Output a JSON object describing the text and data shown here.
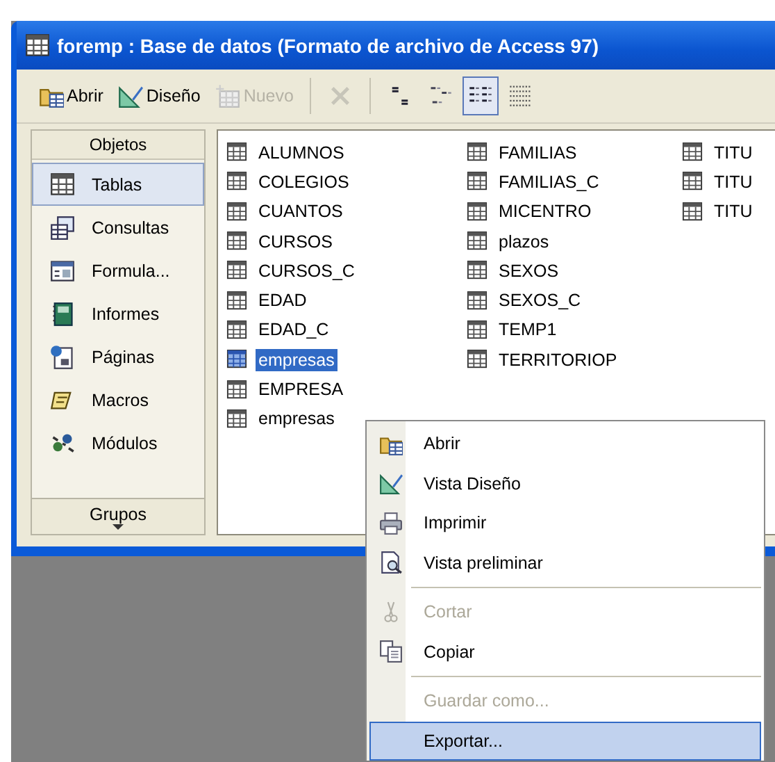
{
  "window": {
    "title": "foremp : Base de datos (Formato de archivo de Access 97)"
  },
  "toolbar": [
    {
      "kind": "button",
      "label": "Abrir",
      "disabled": false
    },
    {
      "kind": "button",
      "label": "Diseño",
      "disabled": false
    },
    {
      "kind": "button",
      "label": "Nuevo",
      "disabled": true
    },
    {
      "kind": "separator"
    },
    {
      "kind": "delete",
      "disabled": true
    },
    {
      "kind": "separator"
    },
    {
      "kind": "view",
      "selected": false
    },
    {
      "kind": "view",
      "selected": false
    },
    {
      "kind": "view",
      "selected": true
    },
    {
      "kind": "view",
      "selected": false
    }
  ],
  "sidebar": {
    "header": "Objetos",
    "items": [
      {
        "label": "Tablas",
        "selected": true
      },
      {
        "label": "Consultas",
        "selected": false
      },
      {
        "label": "Formula...",
        "selected": false
      },
      {
        "label": "Informes",
        "selected": false
      },
      {
        "label": "Páginas",
        "selected": false
      },
      {
        "label": "Macros",
        "selected": false
      },
      {
        "label": "Módulos",
        "selected": false
      }
    ],
    "groups": "Grupos"
  },
  "objects": [
    {
      "items": [
        {
          "name": "ALUMNOS",
          "selected": false
        },
        {
          "name": "COLEGIOS",
          "selected": false
        },
        {
          "name": "CUANTOS",
          "selected": false
        },
        {
          "name": "CURSOS",
          "selected": false
        },
        {
          "name": "CURSOS_C",
          "selected": false
        },
        {
          "name": "EDAD",
          "selected": false
        },
        {
          "name": "EDAD_C",
          "selected": false
        },
        {
          "name": "empresas",
          "selected": true
        },
        {
          "name": "EMPRESA",
          "selected": false
        },
        {
          "name": "empresas",
          "selected": false
        }
      ]
    },
    {
      "items": [
        {
          "name": "FAMILIAS",
          "selected": false
        },
        {
          "name": "FAMILIAS_C",
          "selected": false
        },
        {
          "name": "MICENTRO",
          "selected": false
        },
        {
          "name": "plazos",
          "selected": false
        },
        {
          "name": "SEXOS",
          "selected": false
        },
        {
          "name": "SEXOS_C",
          "selected": false
        },
        {
          "name": "TEMP1",
          "selected": false
        },
        {
          "name": "TERRITORIOP",
          "selected": false
        }
      ]
    },
    {
      "items": [
        {
          "name": "TITU",
          "selected": false
        },
        {
          "name": "TITU",
          "selected": false
        },
        {
          "name": "TITU",
          "selected": false
        }
      ]
    }
  ],
  "context_menu": [
    {
      "kind": "item",
      "label": "Abrir",
      "disabled": false,
      "selected": false
    },
    {
      "kind": "item",
      "label": "Vista Diseño",
      "disabled": false,
      "selected": false
    },
    {
      "kind": "item",
      "label": "Imprimir",
      "disabled": false,
      "selected": false
    },
    {
      "kind": "item",
      "label": "Vista preliminar",
      "disabled": false,
      "selected": false
    },
    {
      "kind": "separator"
    },
    {
      "kind": "item",
      "label": "Cortar",
      "disabled": true,
      "selected": false
    },
    {
      "kind": "item",
      "label": "Copiar",
      "disabled": false,
      "selected": false
    },
    {
      "kind": "separator"
    },
    {
      "kind": "item",
      "label": "Guardar como...",
      "disabled": true,
      "selected": false
    },
    {
      "kind": "item",
      "label": "Exportar...",
      "disabled": false,
      "selected": true
    }
  ]
}
